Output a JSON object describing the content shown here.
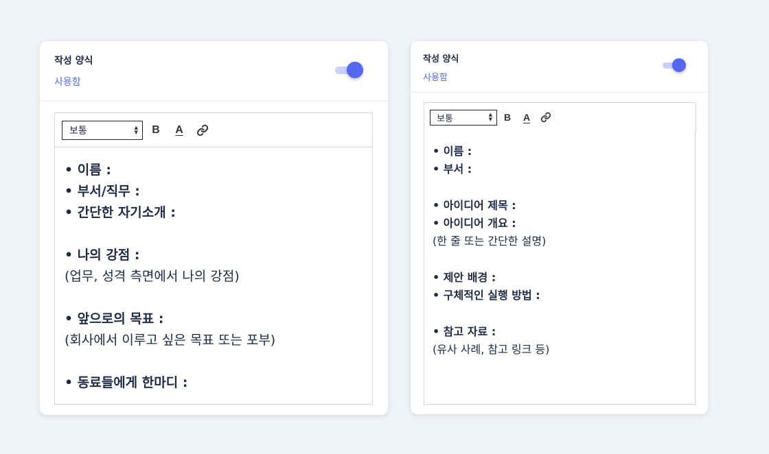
{
  "cards": [
    {
      "title": "작성 양식",
      "status": "사용함",
      "toolbar": {
        "format": "보통",
        "bold": "B",
        "color": "A"
      },
      "lines": [
        {
          "text": "• 이름 :",
          "bold": true
        },
        {
          "text": "• 부서/직무 :",
          "bold": true
        },
        {
          "text": "• 간단한 자기소개 :",
          "bold": true
        },
        {
          "text": "",
          "bold": false
        },
        {
          "text": "• 나의 강점 :",
          "bold": true
        },
        {
          "text": "(업무, 성격 측면에서 나의 강점)",
          "bold": false
        },
        {
          "text": "",
          "bold": false
        },
        {
          "text": "• 앞으로의 목표 :",
          "bold": true
        },
        {
          "text": "(회사에서 이루고 싶은 목표 또는 포부)",
          "bold": false
        },
        {
          "text": "",
          "bold": false
        },
        {
          "text": "• 동료들에게 한마디 :",
          "bold": true
        }
      ]
    },
    {
      "title": "작성 양식",
      "status": "사용함",
      "toolbar": {
        "format": "보통",
        "bold": "B",
        "color": "A"
      },
      "lines": [
        {
          "text": "• 이름 :",
          "bold": true
        },
        {
          "text": "• 부서 :",
          "bold": true
        },
        {
          "text": "",
          "bold": false
        },
        {
          "text": "• 아이디어 제목 :",
          "bold": true
        },
        {
          "text": "• 아이디어 개요 :",
          "bold": true
        },
        {
          "text": "(한 줄 또는 간단한 설명)",
          "bold": false
        },
        {
          "text": "",
          "bold": false
        },
        {
          "text": "• 제안 배경 :",
          "bold": true
        },
        {
          "text": "• 구체적인 실행 방법 :",
          "bold": true
        },
        {
          "text": "",
          "bold": false
        },
        {
          "text": "• 참고 자료 :",
          "bold": true
        },
        {
          "text": "(유사 사례, 참고 링크 등)",
          "bold": false
        }
      ]
    }
  ],
  "colors": {
    "accent": "#5667f0",
    "accent_light": "#c9d2f7",
    "status_text": "#5b6cd8",
    "background": "#f0f3f8"
  },
  "icons": {
    "select_arrows": "up-down-chevron-icon",
    "link": "link-icon"
  }
}
